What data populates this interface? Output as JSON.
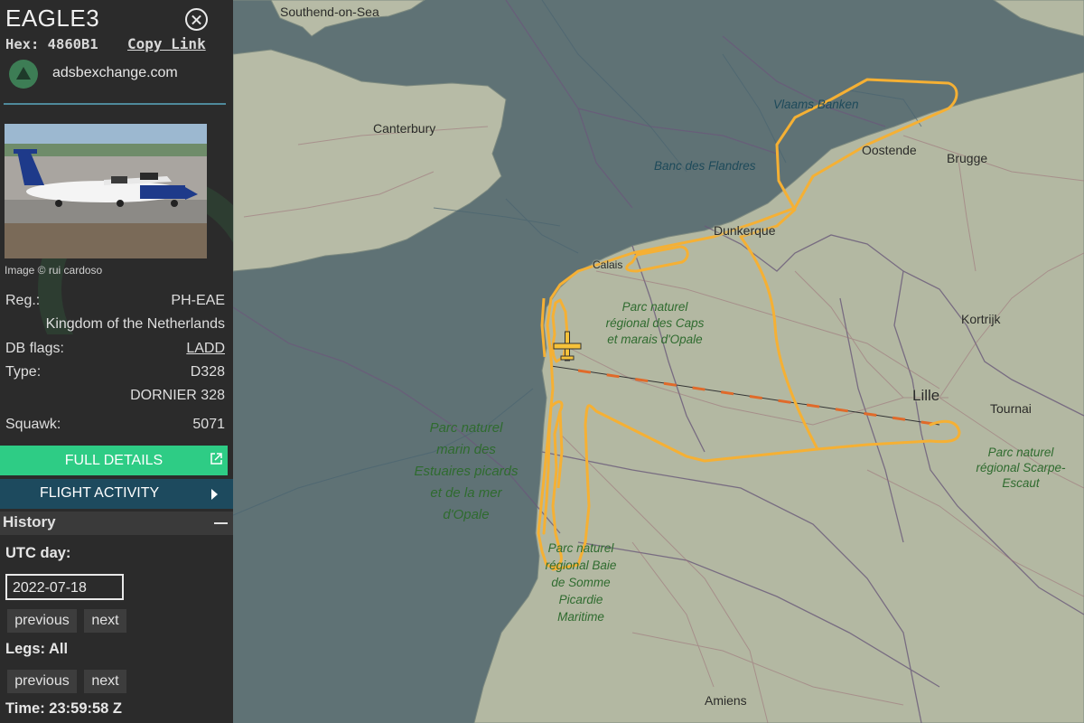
{
  "aircraft": {
    "callsign": "EAGLE3",
    "hex_label": "Hex:",
    "hex": "4860B1",
    "copy_link": "Copy Link",
    "source": "adsbexchange.com",
    "photo_credit": "Image © rui cardoso",
    "registration_label": "Reg.:",
    "registration": "PH-EAE",
    "country": "Kingdom of the Netherlands",
    "db_flags_label": "DB flags:",
    "db_flags": "LADD",
    "type_label": "Type:",
    "type_code": "D328",
    "type_name": "DORNIER 328",
    "squawk_label": "Squawk:",
    "squawk": "5071"
  },
  "buttons": {
    "full_details": "FULL DETAILS",
    "flight_activity": "FLIGHT ACTIVITY"
  },
  "history": {
    "title": "History",
    "utc_day_label": "UTC day:",
    "utc_day_value": "2022-07-18",
    "previous": "previous",
    "next": "next",
    "legs_label": "Legs: All",
    "time_label": "Time: 23:59:58 Z"
  },
  "map": {
    "places": [
      "Southend-on-Sea",
      "Canterbury",
      "Brugge",
      "Oostende",
      "Dunkerque",
      "Calais",
      "Kortrijk",
      "Lille",
      "Tournai",
      "Amiens"
    ],
    "sea_labels": [
      "Vlaams Banken",
      "Banc des Flandres"
    ],
    "park_labels": [
      "Parc naturel régional des Caps et marais d'Opale",
      "Parc naturel marin des Estuaires picards et de la mer d'Opale",
      "Parc naturel régional Baie de Somme Picardie Maritime",
      "Parc naturel régional Scarpe-Escaut"
    ]
  },
  "colors": {
    "sea": "#5f7275",
    "land": "#b7bba6",
    "track": "#f5b034",
    "sidebar_bg": "#2b2b2b",
    "full_details_bg": "#2ecc85",
    "flight_activity_bg": "#1d4a5e"
  },
  "icons": {
    "close": "close-icon",
    "source": "adsbx-logo-icon",
    "external": "external-link-icon",
    "chevron": "chevron-right-icon",
    "collapse": "minus-icon",
    "aircraft": "aircraft-icon"
  }
}
